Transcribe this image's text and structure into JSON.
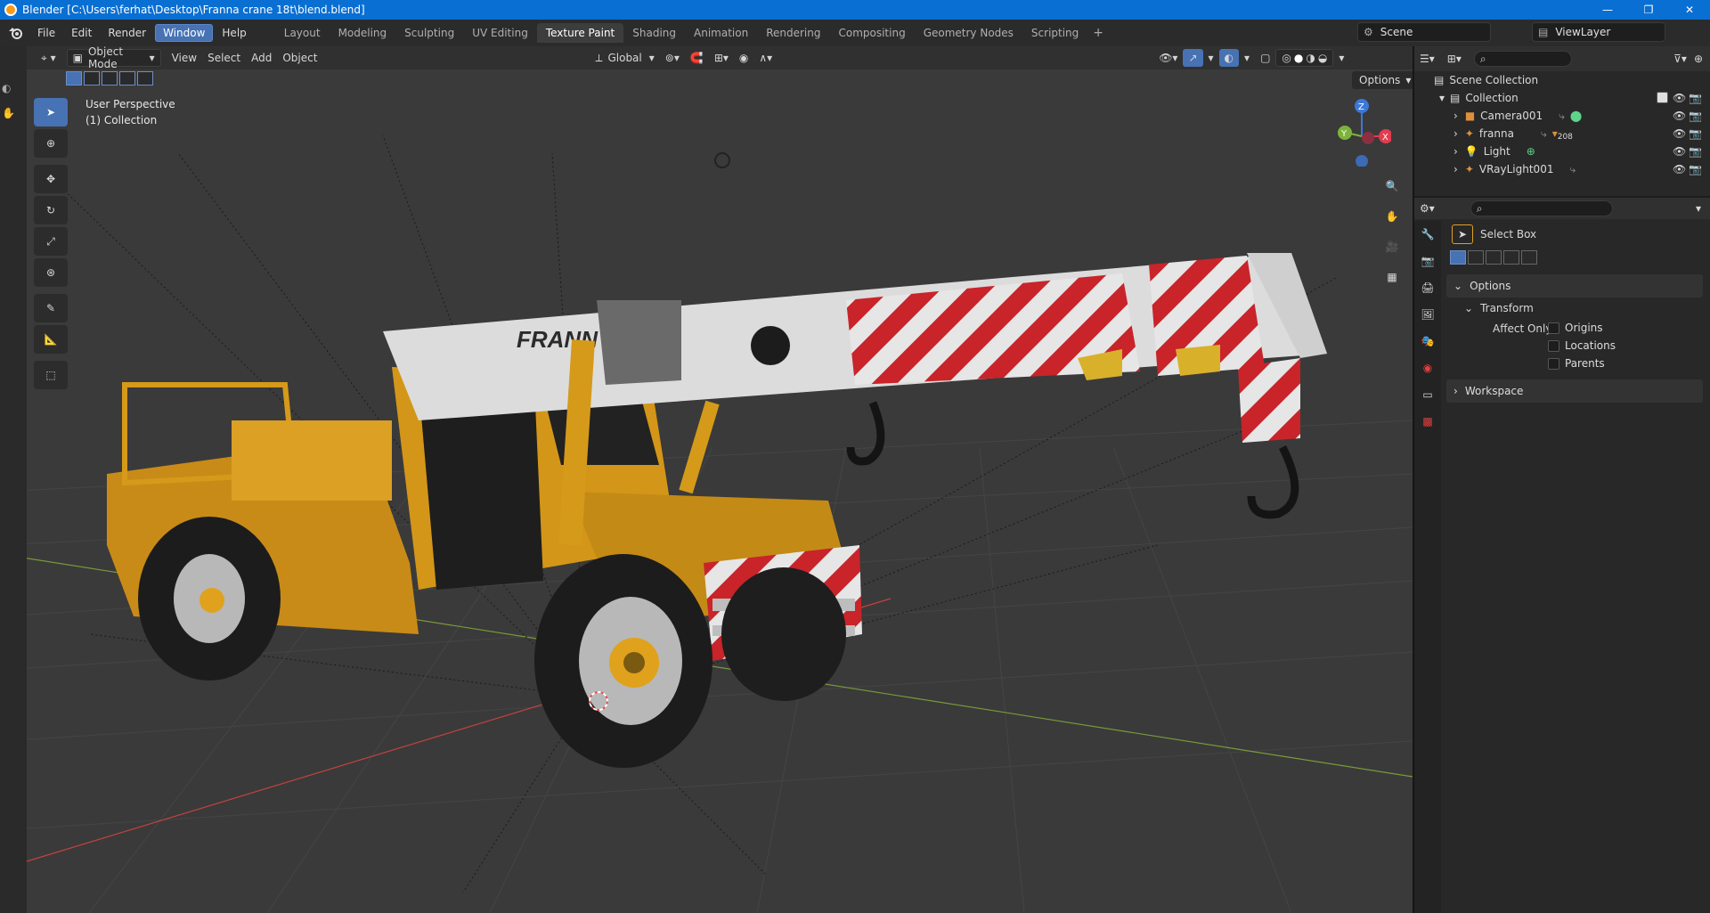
{
  "window": {
    "title": "Blender [C:\\Users\\ferhat\\Desktop\\Franna crane 18t\\blend.blend]",
    "controls": [
      "—",
      "❐",
      "✕"
    ]
  },
  "menubar": {
    "menus": [
      "File",
      "Edit",
      "Render",
      "Window",
      "Help"
    ],
    "active_menu": "Window",
    "workspaces": [
      "Layout",
      "Modeling",
      "Sculpting",
      "UV Editing",
      "Texture Paint",
      "Shading",
      "Animation",
      "Rendering",
      "Compositing",
      "Geometry Nodes",
      "Scripting"
    ],
    "active_workspace": "Texture Paint",
    "add_workspace": "+",
    "scene": "Scene",
    "view_layer": "ViewLayer"
  },
  "viewport": {
    "mode": "Object Mode",
    "menus": [
      "View",
      "Select",
      "Add",
      "Object"
    ],
    "orientation": "Global",
    "options_label": "Options",
    "perspective_label": "User Perspective",
    "collection_label": "(1) Collection",
    "gizmo_axes": {
      "z": "Z",
      "y": "Y",
      "x": "X"
    },
    "colors": {
      "x_axis": "#e23d4f",
      "y_axis": "#7cb43a",
      "z_axis": "#3c78d8",
      "body": "#e0a11d",
      "boom": "#d9d9d9",
      "stripe": "#c8242a"
    }
  },
  "tools": [
    "select-box",
    "cursor",
    "move",
    "rotate",
    "scale",
    "transform",
    "annotate",
    "measure",
    "add-cube"
  ],
  "outliner": {
    "root": "Scene Collection",
    "collection": "Collection",
    "items": [
      {
        "name": "Camera001"
      },
      {
        "name": "franna",
        "badge": "208"
      },
      {
        "name": "Light"
      },
      {
        "name": "VRayLight001"
      }
    ]
  },
  "properties": {
    "tool_name": "Select Box",
    "options_panel": "Options",
    "transform_panel": "Transform",
    "affect_only_label": "Affect Only",
    "checks": [
      "Origins",
      "Locations",
      "Parents"
    ],
    "workspace_panel": "Workspace"
  }
}
